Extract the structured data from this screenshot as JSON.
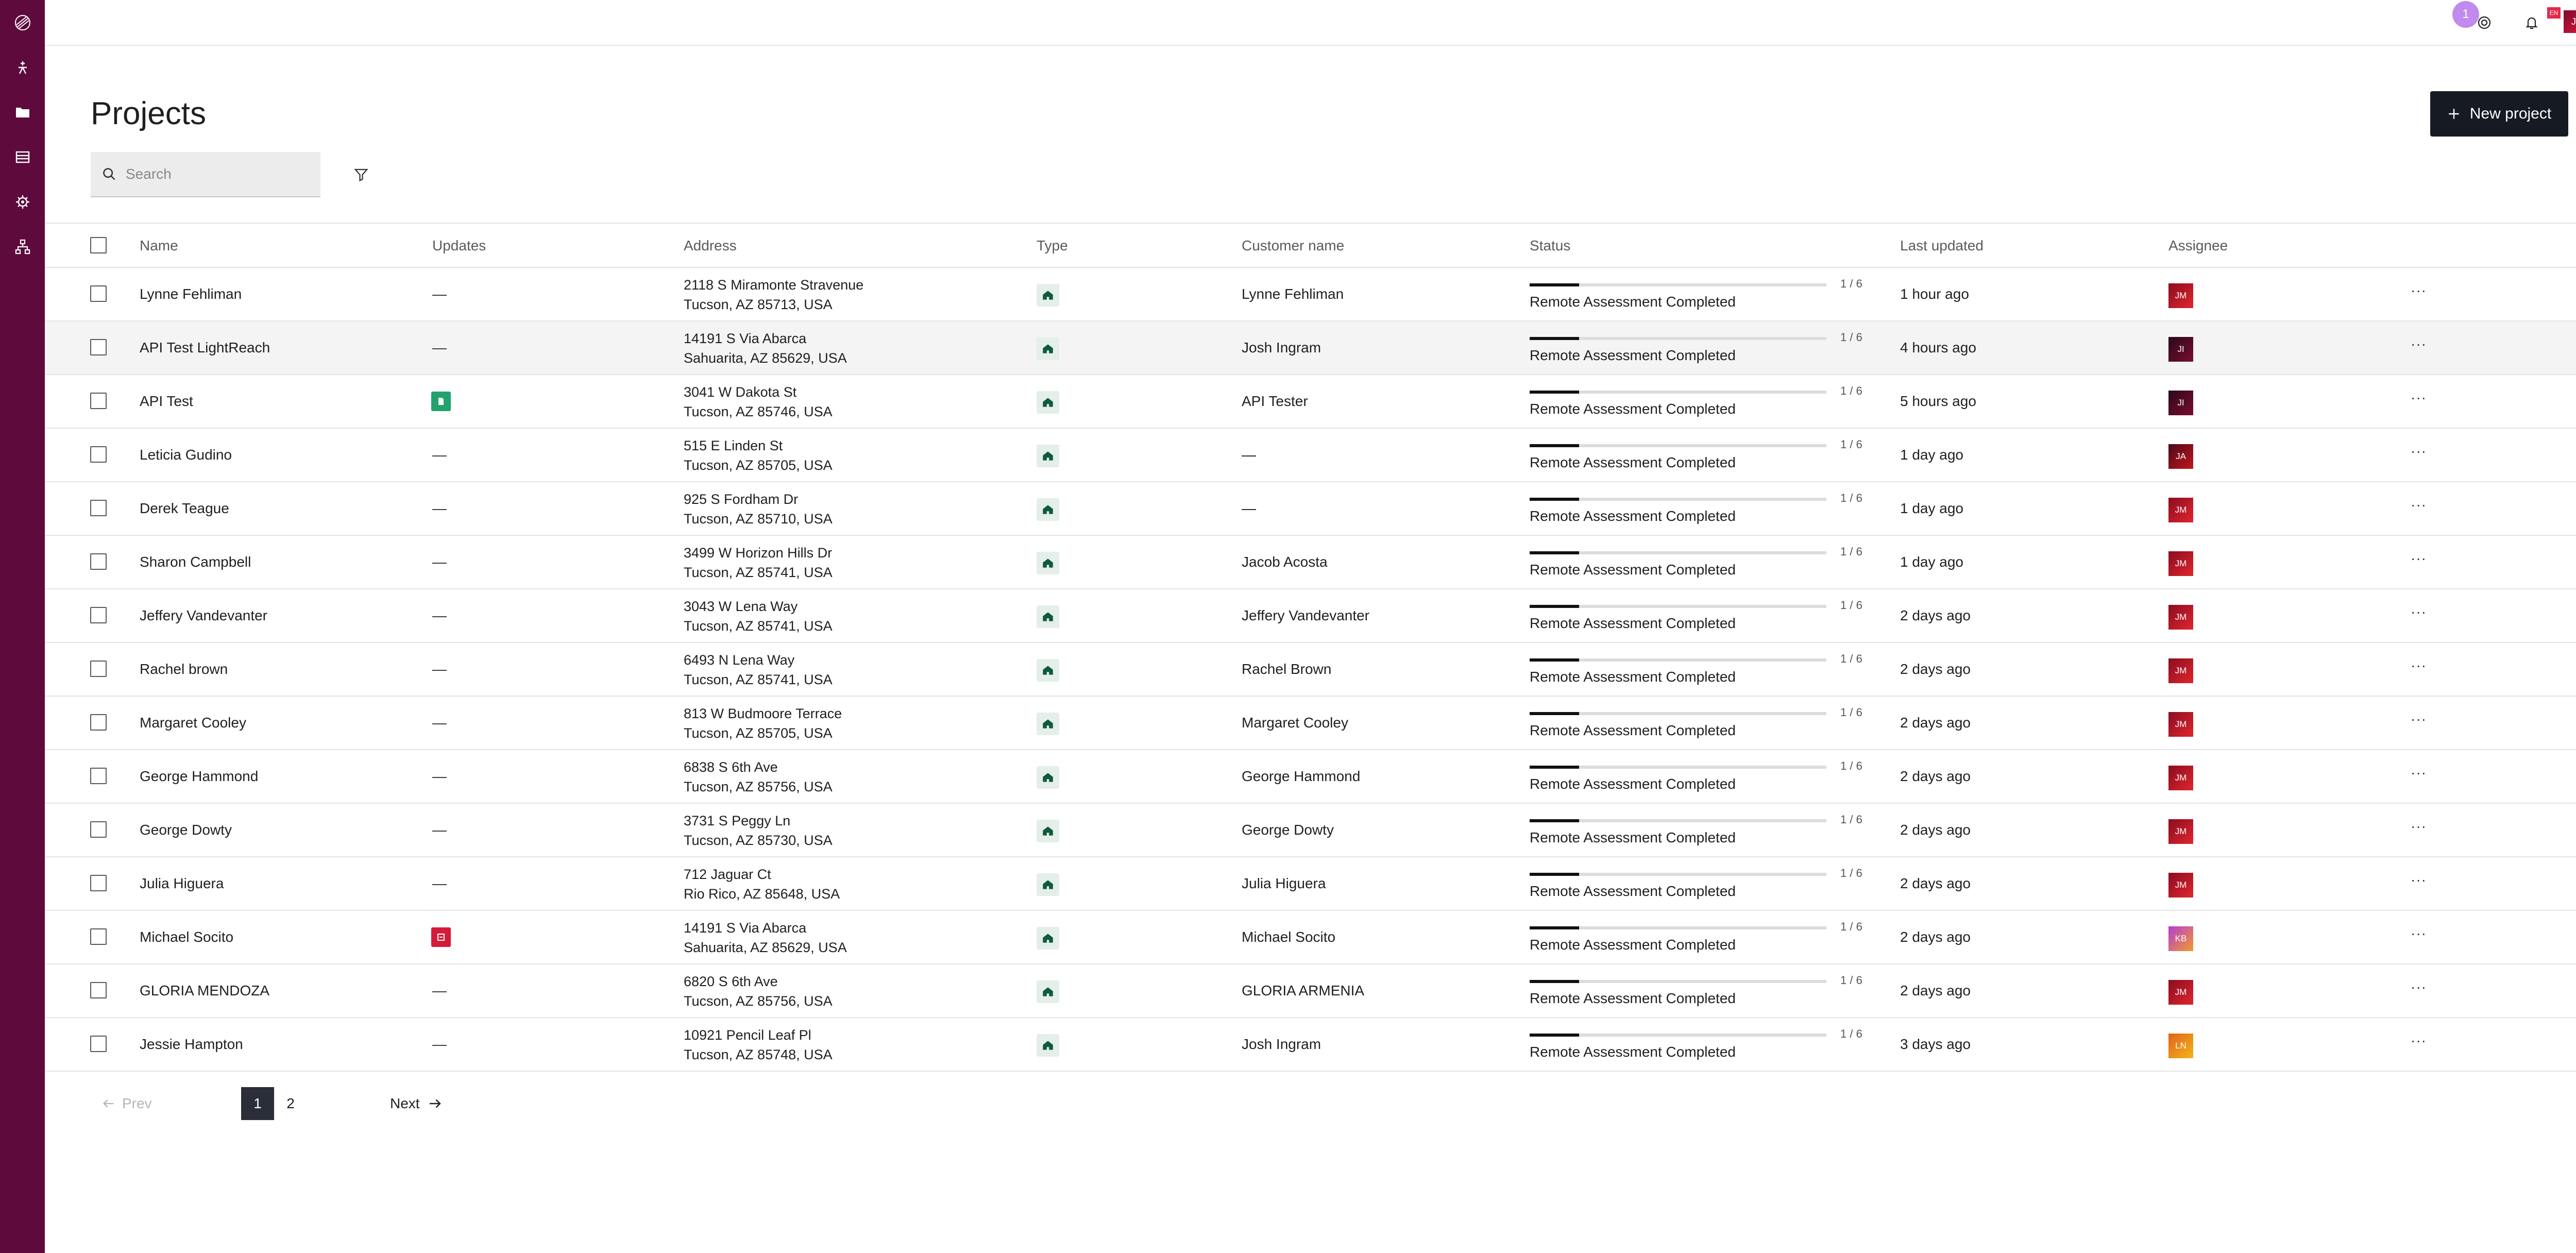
{
  "header": {
    "title": "Projects",
    "new_project_label": "New project",
    "search_placeholder": "Search",
    "notification_count": "1"
  },
  "user": {
    "initials": "JI",
    "flag": "EN"
  },
  "columns": [
    "Name",
    "Updates",
    "Address",
    "Type",
    "Customer name",
    "Status",
    "Last updated",
    "Assignee"
  ],
  "rows": [
    {
      "name": "Lynne Fehliman",
      "update": "—",
      "addr1": "2118 S Miramonte Stravenue",
      "addr2": "Tucson, AZ 85713, USA",
      "customer": "Lynne Fehliman",
      "progress": "1 / 6",
      "status": "Remote Assessment Completed",
      "updated": "1 hour ago",
      "assignee": "JM"
    },
    {
      "name": "API Test LightReach",
      "update": "—",
      "addr1": "14191 S Via Abarca",
      "addr2": "Sahuarita, AZ 85629, USA",
      "customer": "Josh Ingram",
      "progress": "1 / 6",
      "status": "Remote Assessment Completed",
      "updated": "4 hours ago",
      "assignee": "JI"
    },
    {
      "name": "API Test",
      "update": "doc",
      "addr1": "3041 W Dakota St",
      "addr2": "Tucson, AZ 85746, USA",
      "customer": "API Tester",
      "progress": "1 / 6",
      "status": "Remote Assessment Completed",
      "updated": "5 hours ago",
      "assignee": "JI"
    },
    {
      "name": "Leticia Gudino",
      "update": "—",
      "addr1": "515 E Linden St",
      "addr2": "Tucson, AZ 85705, USA",
      "customer": "—",
      "progress": "1 / 6",
      "status": "Remote Assessment Completed",
      "updated": "1 day ago",
      "assignee": "JA"
    },
    {
      "name": "Derek Teague",
      "update": "—",
      "addr1": "925 S Fordham Dr",
      "addr2": "Tucson, AZ 85710, USA",
      "customer": "—",
      "progress": "1 / 6",
      "status": "Remote Assessment Completed",
      "updated": "1 day ago",
      "assignee": "JM"
    },
    {
      "name": "Sharon Campbell",
      "update": "—",
      "addr1": "3499 W Horizon Hills Dr",
      "addr2": "Tucson, AZ 85741, USA",
      "customer": "Jacob Acosta",
      "progress": "1 / 6",
      "status": "Remote Assessment Completed",
      "updated": "1 day ago",
      "assignee": "JM"
    },
    {
      "name": "Jeffery Vandevanter",
      "update": "—",
      "addr1": "3043 W Lena Way",
      "addr2": "Tucson, AZ 85741, USA",
      "customer": "Jeffery Vandevanter",
      "progress": "1 / 6",
      "status": "Remote Assessment Completed",
      "updated": "2 days ago",
      "assignee": "JM"
    },
    {
      "name": "Rachel brown",
      "update": "—",
      "addr1": "6493 N Lena Way",
      "addr2": "Tucson, AZ 85741, USA",
      "customer": "Rachel Brown",
      "progress": "1 / 6",
      "status": "Remote Assessment Completed",
      "updated": "2 days ago",
      "assignee": "JM"
    },
    {
      "name": "Margaret Cooley",
      "update": "—",
      "addr1": "813 W Budmoore Terrace",
      "addr2": "Tucson, AZ 85705, USA",
      "customer": "Margaret Cooley",
      "progress": "1 / 6",
      "status": "Remote Assessment Completed",
      "updated": "2 days ago",
      "assignee": "JM"
    },
    {
      "name": "George Hammond",
      "update": "—",
      "addr1": "6838 S 6th Ave",
      "addr2": "Tucson, AZ 85756, USA",
      "customer": "George Hammond",
      "progress": "1 / 6",
      "status": "Remote Assessment Completed",
      "updated": "2 days ago",
      "assignee": "JM"
    },
    {
      "name": "George Dowty",
      "update": "—",
      "addr1": "3731 S Peggy Ln",
      "addr2": "Tucson, AZ 85730, USA",
      "customer": "George Dowty",
      "progress": "1 / 6",
      "status": "Remote Assessment Completed",
      "updated": "2 days ago",
      "assignee": "JM"
    },
    {
      "name": "Julia Higuera",
      "update": "—",
      "addr1": "712 Jaguar Ct",
      "addr2": "Rio Rico, AZ 85648, USA",
      "customer": "Julia Higuera",
      "progress": "1 / 6",
      "status": "Remote Assessment Completed",
      "updated": "2 days ago",
      "assignee": "JM"
    },
    {
      "name": "Michael Socito",
      "update": "pdf",
      "addr1": "14191 S Via Abarca",
      "addr2": "Sahuarita, AZ 85629, USA",
      "customer": "Michael Socito",
      "progress": "1 / 6",
      "status": "Remote Assessment Completed",
      "updated": "2 days ago",
      "assignee": "KB"
    },
    {
      "name": "GLORIA MENDOZA",
      "update": "—",
      "addr1": "6820 S 6th Ave",
      "addr2": "Tucson, AZ 85756, USA",
      "customer": "GLORIA ARMENIA",
      "progress": "1 / 6",
      "status": "Remote Assessment Completed",
      "updated": "2 days ago",
      "assignee": "JM"
    },
    {
      "name": "Jessie Hampton",
      "update": "—",
      "addr1": "10921 Pencil Leaf Pl",
      "addr2": "Tucson, AZ 85748, USA",
      "customer": "Josh Ingram",
      "progress": "1 / 6",
      "status": "Remote Assessment Completed",
      "updated": "3 days ago",
      "assignee": "LN"
    }
  ],
  "pagination": {
    "prev": "Prev",
    "pages": [
      "1",
      "2"
    ],
    "next": "Next"
  },
  "colors": {
    "rail": "#5e0a3d",
    "primary_button": "#161a23",
    "home_icon": "#0f5a3c",
    "jm": "#c4161c",
    "ji": "#5e0a3d",
    "ja": "#8a0e2a",
    "kb": "#b43cd6",
    "ln": "#e08a16"
  }
}
